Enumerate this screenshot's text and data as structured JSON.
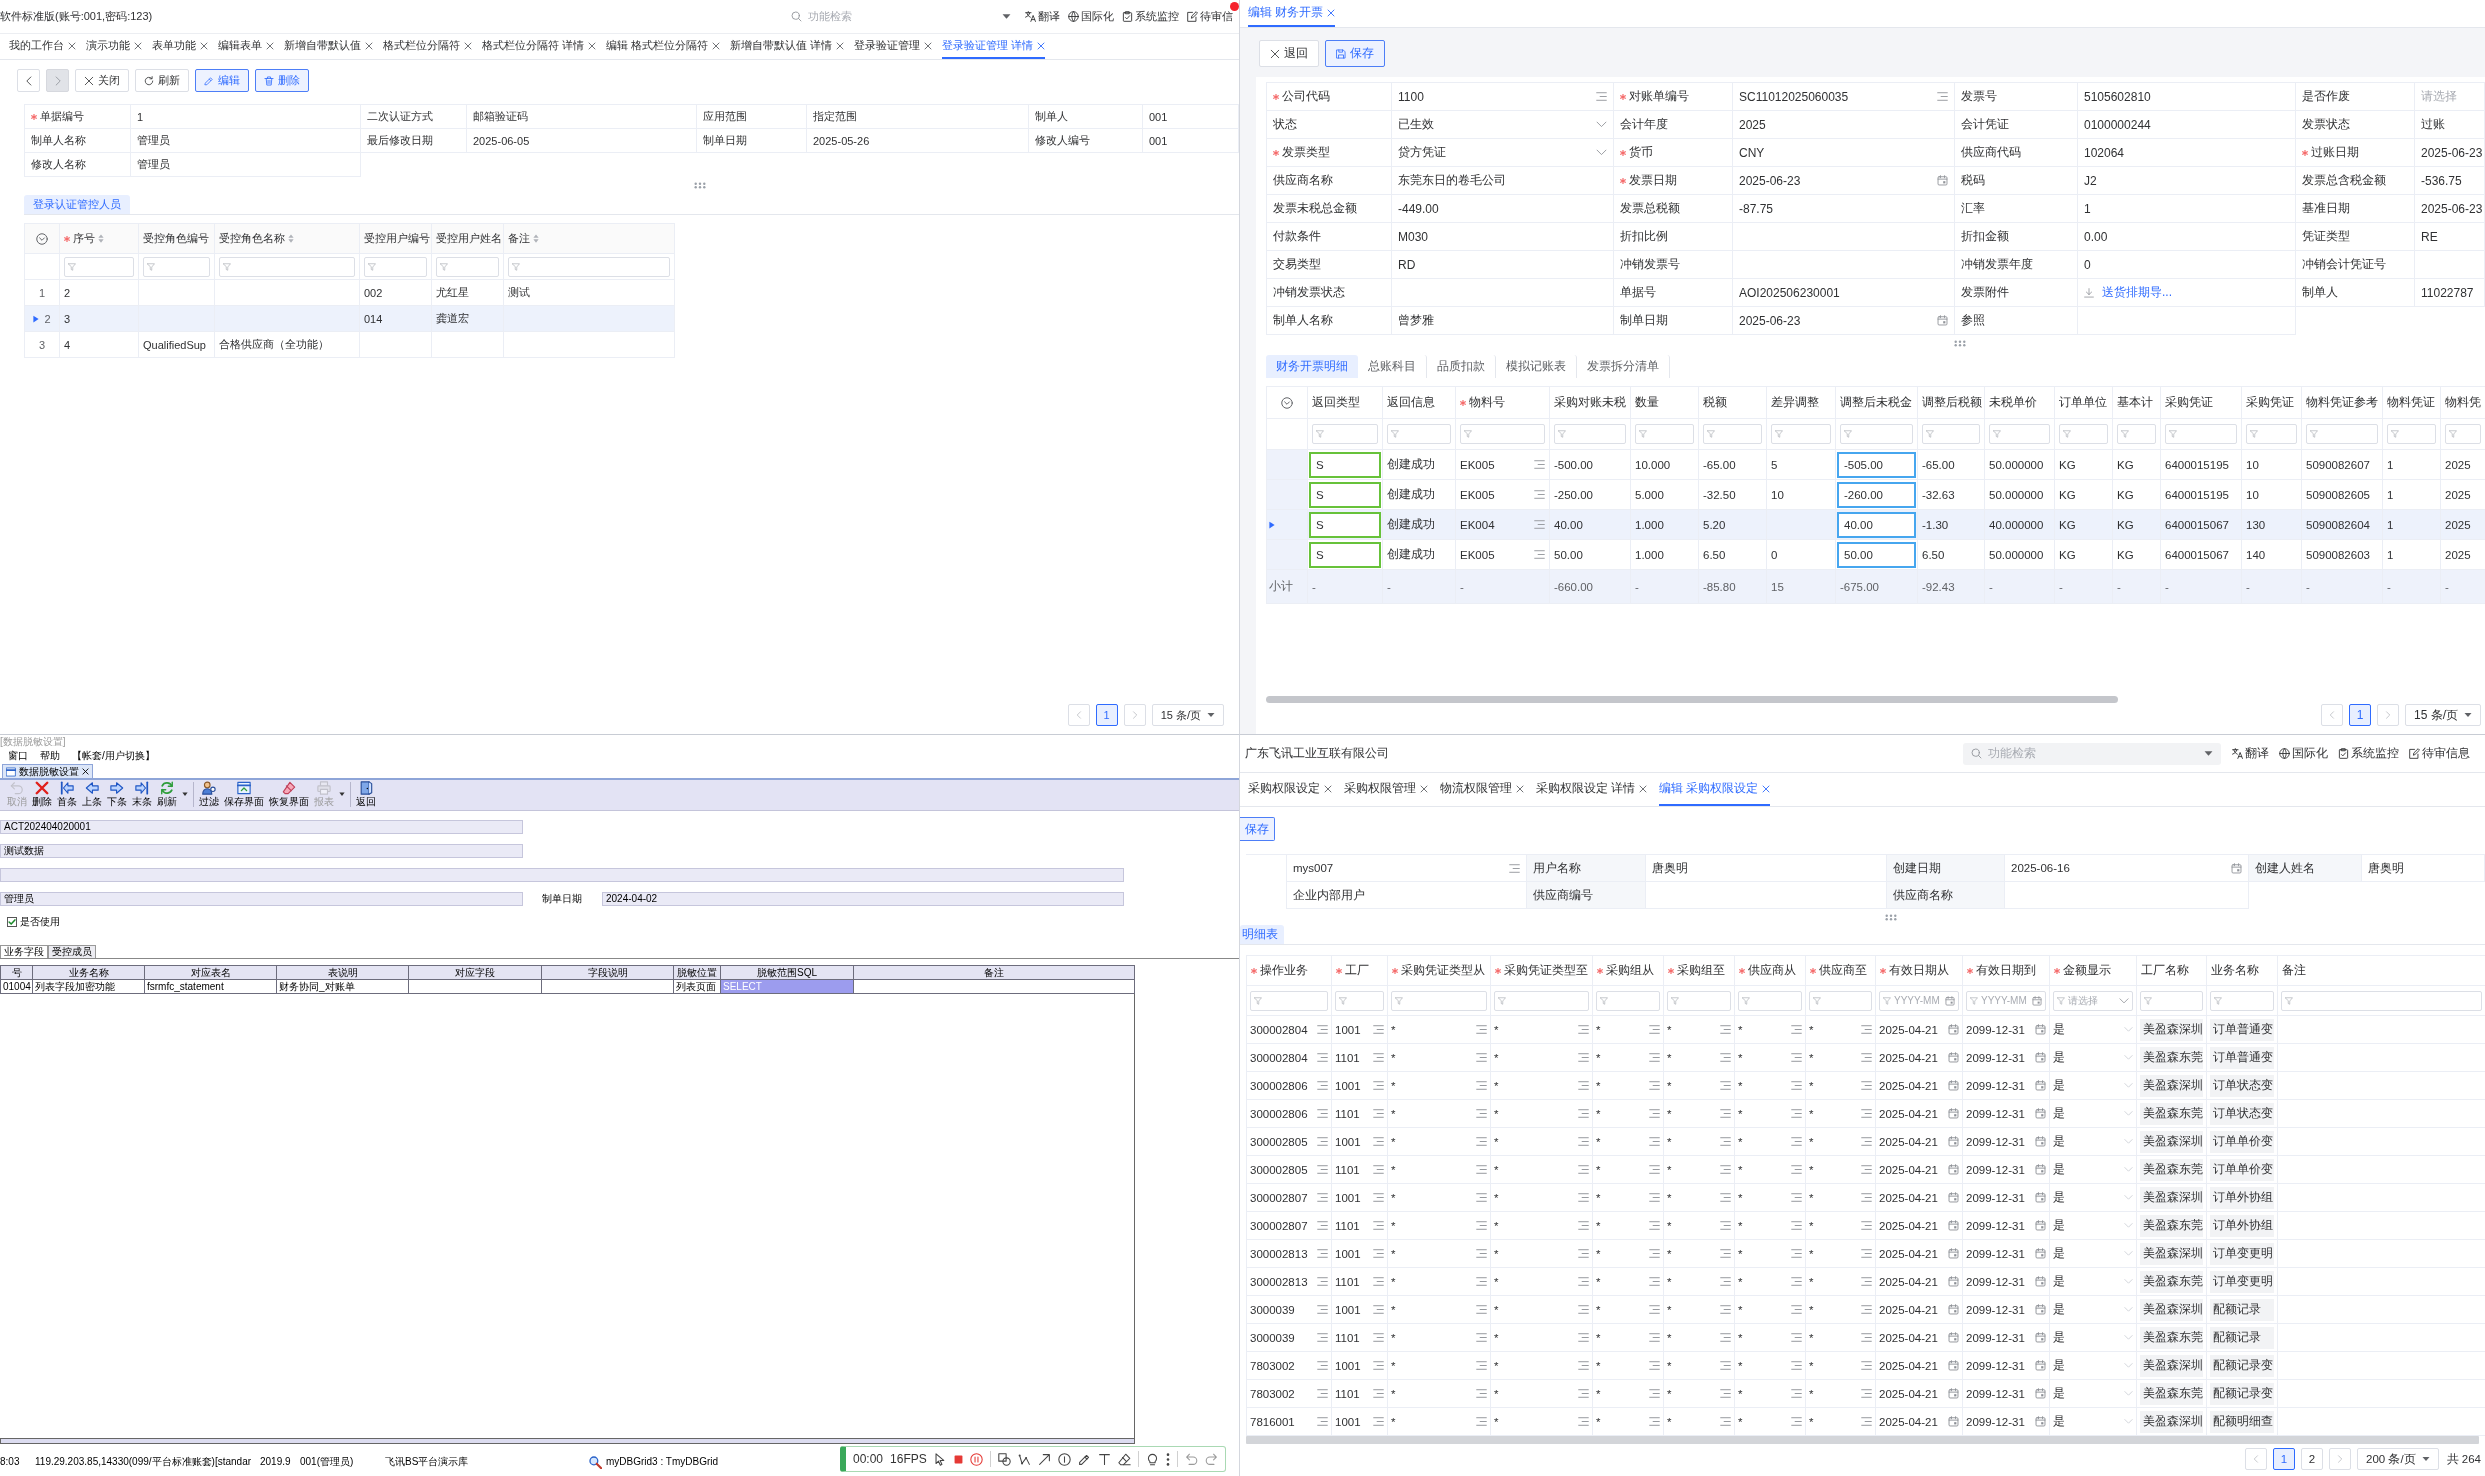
{
  "verify_page": {
    "header": {
      "title": "软件标准版(账号:001,密码:123)",
      "search": {
        "placeholder": "功能检索"
      },
      "links": [
        {
          "kind": "translate",
          "label": "翻译",
          "alert": false
        },
        {
          "kind": "globe",
          "label": "国际化",
          "alert": false
        },
        {
          "kind": "clipboard",
          "label": "系统监控",
          "alert": false
        },
        {
          "kind": "note",
          "label": "待审信",
          "alert": true
        }
      ]
    },
    "tabs": [
      {
        "label": "我的工作台",
        "selected": false
      },
      {
        "label": "演示功能",
        "selected": false
      },
      {
        "label": "表单功能",
        "selected": false
      },
      {
        "label": "编辑表单",
        "selected": false
      },
      {
        "label": "新增自带默认值",
        "selected": false
      },
      {
        "label": "格式栏位分隔符",
        "selected": false
      },
      {
        "label": "格式栏位分隔符 详情",
        "selected": false
      },
      {
        "label": "编辑 格式栏位分隔符",
        "selected": false
      },
      {
        "label": "新增自带默认值 详情",
        "selected": false
      },
      {
        "label": "登录验证管理",
        "selected": false
      },
      {
        "label": "登录验证管理 详情",
        "selected": true
      }
    ],
    "toolbar": [
      {
        "kind": "previous",
        "primary": false,
        "disabled": false
      },
      {
        "kind": "next",
        "primary": false,
        "disabled": true
      },
      {
        "kind": "close",
        "label": "关闭",
        "primary": false,
        "disabled": false
      },
      {
        "kind": "refresh",
        "label": "刷新",
        "primary": false,
        "disabled": false
      },
      {
        "kind": "edit",
        "label": "编辑",
        "primary": true,
        "disabled": false
      },
      {
        "kind": "delete",
        "label": "删除",
        "primary": true,
        "disabled": false
      }
    ],
    "form": {
      "fields": [
        {
          "label": "单据编号",
          "required": true,
          "value": "1"
        },
        {
          "label": "二次认证方式",
          "required": false,
          "value": "邮箱验证码"
        },
        {
          "label": "应用范围",
          "required": false,
          "value": "指定范围"
        },
        {
          "label": "制单人",
          "required": false,
          "value": "001"
        },
        {
          "label": "制单人名称",
          "required": false,
          "value": "管理员"
        },
        {
          "label": "最后修改日期",
          "required": false,
          "value": "2025-06-05"
        },
        {
          "label": "制单日期",
          "required": false,
          "value": "2025-05-26"
        },
        {
          "label": "修改人编号",
          "required": false,
          "value": "001"
        },
        {
          "label": "修改人名称",
          "required": false,
          "value": "管理员"
        }
      ]
    },
    "subtabs": [
      {
        "label": "登录认证管控人员",
        "selected": true
      }
    ],
    "grid": {
      "columns": [
        {
          "label": "序号",
          "required": true,
          "sortable": true
        },
        {
          "label": "受控角色编号",
          "required": false,
          "sortable": false
        },
        {
          "label": "受控角色名称",
          "required": false,
          "sortable": true
        },
        {
          "label": "受控用户编号",
          "required": false,
          "sortable": false
        },
        {
          "label": "受控用户姓名",
          "required": false,
          "sortable": false
        },
        {
          "label": "备注",
          "required": false,
          "sortable": true
        }
      ],
      "rows": [
        {
          "number": "1",
          "selected": false,
          "cells": [
            "2",
            null,
            null,
            "002",
            "尤红星",
            "测试"
          ]
        },
        {
          "number": "2",
          "selected": true,
          "cells": [
            "3",
            null,
            null,
            "014",
            "龚道宏",
            null
          ]
        },
        {
          "number": "3",
          "selected": false,
          "cells": [
            "4",
            "QualifiedSup",
            "合格供应商（全功能）",
            null,
            null,
            null
          ]
        }
      ]
    },
    "pagination": {
      "pages": [
        {
          "label": "1",
          "selected": true
        }
      ],
      "page_size": "15 条/页"
    }
  },
  "invoice_page": {
    "tabs": [
      {
        "label": "编辑 财务开票",
        "selected": true
      }
    ],
    "toolbar": [
      {
        "kind": "return",
        "label": "退回",
        "primary": false
      },
      {
        "kind": "save",
        "label": "保存",
        "primary": true
      }
    ],
    "form": {
      "fields": [
        {
          "label": "公司代码",
          "required": true,
          "kind": "lookup",
          "value": "1100"
        },
        {
          "label": "对账单编号",
          "required": true,
          "kind": "lookup",
          "value": "SC11012025060035"
        },
        {
          "label": "发票号",
          "required": false,
          "kind": "text",
          "value": "5105602810"
        },
        {
          "label": "是否作废",
          "required": false,
          "kind": "text",
          "placeholder": "请选择"
        },
        {
          "label": "状态",
          "required": false,
          "kind": "select",
          "value": "已生效"
        },
        {
          "label": "会计年度",
          "required": false,
          "kind": "text",
          "value": "2025"
        },
        {
          "label": "会计凭证",
          "required": false,
          "kind": "text",
          "value": "0100000244"
        },
        {
          "label": "发票状态",
          "required": false,
          "kind": "text",
          "value": "过账"
        },
        {
          "label": "发票类型",
          "required": true,
          "kind": "select",
          "value": "贷方凭证"
        },
        {
          "label": "货币",
          "required": true,
          "kind": "text",
          "value": "CNY"
        },
        {
          "label": "供应商代码",
          "required": false,
          "kind": "text",
          "value": "102064"
        },
        {
          "label": "过账日期",
          "required": true,
          "kind": "text",
          "value": "2025-06-23"
        },
        {
          "label": "供应商名称",
          "required": false,
          "kind": "text",
          "value": "东莞东日的卷毛公司"
        },
        {
          "label": "发票日期",
          "required": true,
          "kind": "date",
          "value": "2025-06-23"
        },
        {
          "label": "税码",
          "required": false,
          "kind": "text",
          "value": "J2"
        },
        {
          "label": "发票总含税金额",
          "required": false,
          "kind": "text",
          "value": "-536.75"
        },
        {
          "label": "发票未税总金额",
          "required": false,
          "kind": "text",
          "value": "-449.00"
        },
        {
          "label": "发票总税额",
          "required": false,
          "kind": "text",
          "value": "-87.75"
        },
        {
          "label": "汇率",
          "required": false,
          "kind": "text",
          "value": "1"
        },
        {
          "label": "基准日期",
          "required": false,
          "kind": "text",
          "value": "2025-06-23"
        },
        {
          "label": "付款条件",
          "required": false,
          "kind": "text",
          "value": "M030"
        },
        {
          "label": "折扣比例",
          "required": false,
          "kind": "text"
        },
        {
          "label": "折扣金额",
          "required": false,
          "kind": "text",
          "value": "0.00"
        },
        {
          "label": "凭证类型",
          "required": false,
          "kind": "text",
          "value": "RE"
        },
        {
          "label": "交易类型",
          "required": false,
          "kind": "text",
          "value": "RD"
        },
        {
          "label": "冲销发票号",
          "required": false,
          "kind": "text"
        },
        {
          "label": "冲销发票年度",
          "required": false,
          "kind": "text",
          "value": "0"
        },
        {
          "label": "冲销会计凭证号",
          "required": false,
          "kind": "text"
        },
        {
          "label": "冲销发票状态",
          "required": false,
          "kind": "text"
        },
        {
          "label": "单据号",
          "required": false,
          "kind": "text",
          "value": "AOI202506230001"
        },
        {
          "label": "发票附件",
          "required": false,
          "kind": "attachment",
          "value": "送货排期导..."
        },
        {
          "label": "制单人",
          "required": false,
          "kind": "text",
          "value": "11022787"
        },
        {
          "label": "制单人名称",
          "required": false,
          "kind": "text",
          "value": "曾梦雅"
        },
        {
          "label": "制单日期",
          "required": false,
          "kind": "date",
          "value": "2025-06-23"
        },
        {
          "label": "参照",
          "required": false,
          "kind": "text"
        }
      ]
    },
    "subtabs": [
      {
        "label": "财务开票明细",
        "selected": true
      },
      {
        "label": "总账科目",
        "selected": false
      },
      {
        "label": "品质扣款",
        "selected": false
      },
      {
        "label": "模拟记账表",
        "selected": false
      },
      {
        "label": "发票拆分清单",
        "selected": false
      }
    ],
    "grid": {
      "columns": [
        {
          "label": "返回类型",
          "required": false,
          "kind": "valid"
        },
        {
          "label": "返回信息",
          "required": false,
          "kind": "plain"
        },
        {
          "label": "物料号",
          "required": true,
          "kind": "lookup"
        },
        {
          "label": "采购对账未税",
          "required": false,
          "kind": "plain"
        },
        {
          "label": "数量",
          "required": false,
          "kind": "plain"
        },
        {
          "label": "税额",
          "required": false,
          "kind": "plain"
        },
        {
          "label": "差异调整",
          "required": false,
          "kind": "plain"
        },
        {
          "label": "调整后未税金",
          "required": false,
          "kind": "editing"
        },
        {
          "label": "调整后税额",
          "required": false,
          "kind": "plain"
        },
        {
          "label": "未税单价",
          "required": false,
          "kind": "plain"
        },
        {
          "label": "订单单位",
          "required": false,
          "kind": "plain"
        },
        {
          "label": "基本计",
          "required": false,
          "kind": "plain"
        },
        {
          "label": "采购凭证",
          "required": false,
          "kind": "plain"
        },
        {
          "label": "采购凭证",
          "required": false,
          "kind": "plain"
        },
        {
          "label": "物料凭证参考",
          "required": false,
          "kind": "plain"
        },
        {
          "label": "物料凭证",
          "required": false,
          "kind": "plain"
        },
        {
          "label": "物料凭",
          "required": false,
          "kind": "plain"
        }
      ],
      "rows": [
        {
          "selected": false,
          "cells": [
            "S",
            "创建成功",
            "EK005",
            "-500.00",
            "10.000",
            "-65.00",
            "5",
            "-505.00",
            "-65.00",
            "50.000000",
            "KG",
            "KG",
            "6400015195",
            "10",
            "5090082607",
            "1",
            "2025"
          ]
        },
        {
          "selected": false,
          "cells": [
            "S",
            "创建成功",
            "EK005",
            "-250.00",
            "5.000",
            "-32.50",
            "10",
            "-260.00",
            "-32.63",
            "50.000000",
            "KG",
            "KG",
            "6400015195",
            "10",
            "5090082605",
            "1",
            "2025"
          ]
        },
        {
          "selected": true,
          "cells": [
            "S",
            "创建成功",
            "EK004",
            "40.00",
            "1.000",
            "5.20",
            null,
            "40.00",
            "-1.30",
            "40.000000",
            "KG",
            "KG",
            "6400015067",
            "130",
            "5090082604",
            "1",
            "2025"
          ]
        },
        {
          "selected": false,
          "cells": [
            "S",
            "创建成功",
            "EK005",
            "50.00",
            "1.000",
            "6.50",
            "0",
            "50.00",
            "6.50",
            "50.000000",
            "KG",
            "KG",
            "6400015067",
            "140",
            "5090082603",
            "1",
            "2025"
          ]
        }
      ],
      "subtotal": {
        "label": "小计",
        "cells": [
          "-",
          "-",
          "-",
          "-660.00",
          "-",
          "-85.80",
          "15",
          "-675.00",
          "-92.43",
          "-",
          "-",
          "-",
          "-",
          "-",
          "-",
          "-",
          "-"
        ]
      }
    },
    "pagination": {
      "pages": [
        {
          "label": "1",
          "selected": true
        }
      ],
      "page_size": "15 条/页"
    }
  },
  "masking_window": {
    "caption": "[数据脱敏设置]",
    "menu": [
      "窗口",
      "帮助",
      "【帐套/用户切换】"
    ],
    "document_tab": {
      "label": "数据脱敏设置"
    },
    "toolbar": [
      {
        "kind": "cancel",
        "label": "取消",
        "disabled": true
      },
      {
        "kind": "delete",
        "label": "删除",
        "disabled": false
      },
      {
        "kind": "first",
        "label": "首条",
        "disabled": false
      },
      {
        "kind": "previous",
        "label": "上条",
        "disabled": false
      },
      {
        "kind": "next",
        "label": "下条",
        "disabled": false
      },
      {
        "kind": "last",
        "label": "末条",
        "disabled": false
      },
      {
        "kind": "refresh",
        "label": "刷新",
        "disabled": false
      },
      {
        "kind": "dropdown",
        "disabled": false
      },
      {
        "kind": "filter",
        "label": "过滤",
        "disabled": false
      },
      {
        "kind": "save_layout",
        "label": "保存界面",
        "disabled": false
      },
      {
        "kind": "restore_layout",
        "label": "恢复界面",
        "disabled": false
      },
      {
        "kind": "report",
        "label": "报表",
        "disabled": true
      },
      {
        "kind": "dropdown",
        "disabled": false
      },
      {
        "kind": "return",
        "label": "返回",
        "disabled": false
      }
    ],
    "form": {
      "field_1": "ACT202404020001",
      "field_2": "测试数据",
      "field_4": "管理员",
      "date": {
        "label": "制单日期",
        "value": "2024-04-02"
      },
      "checkbox": {
        "label": "是否使用",
        "checked": true
      }
    },
    "tabs": [
      {
        "label": "业务字段",
        "selected": true
      },
      {
        "label": "受控成员",
        "selected": false
      }
    ],
    "grid": {
      "columns": [
        "号",
        "业务名称",
        "对应表名",
        "表说明",
        "对应字段",
        "字段说明",
        "脱敏位置",
        "脱敏范围SQL",
        "备注"
      ],
      "rows": [
        {
          "cells": [
            {
              "text": "01004",
              "selected": false
            },
            {
              "text": "列表字段加密功能",
              "selected": false
            },
            {
              "text": "fsrmfc_statement",
              "selected": false
            },
            {
              "text": "财务协同_对账单",
              "selected": false
            },
            null,
            null,
            {
              "text": "列表页面",
              "selected": false
            },
            {
              "text": "SELECT",
              "selected": true
            },
            null
          ]
        }
      ]
    },
    "status_bar": {
      "items": [
        "8:03",
        "119.29.203.85,14330(099/平台标准账套)[standar",
        "2019.9",
        "001(管理员)",
        "飞讯BS平台演示库"
      ],
      "component": "myDBGrid3 : TmyDBGrid"
    },
    "recorder": {
      "time": "00:00",
      "fps": "16FPS",
      "controls": [
        {
          "kind": "cursor"
        },
        {
          "kind": "stop"
        },
        {
          "kind": "pause"
        }
      ],
      "tool_groups": [
        [
          {
            "kind": "shapes"
          },
          {
            "kind": "polyline"
          },
          {
            "kind": "arrow"
          },
          {
            "kind": "counter"
          },
          {
            "kind": "pencil"
          },
          {
            "kind": "text"
          },
          {
            "kind": "eraser"
          }
        ],
        [
          {
            "kind": "bulb"
          },
          {
            "kind": "more"
          }
        ],
        [
          {
            "kind": "undo"
          },
          {
            "kind": "redo"
          }
        ]
      ]
    }
  },
  "permission_page": {
    "header": {
      "title": "广东飞讯工业互联有限公司",
      "search": {
        "placeholder": "功能检索"
      },
      "links": [
        {
          "kind": "translate",
          "label": "翻译",
          "alert": false
        },
        {
          "kind": "globe",
          "label": "国际化",
          "alert": false
        },
        {
          "kind": "clipboard",
          "label": "系统监控",
          "alert": false
        },
        {
          "kind": "note",
          "label": "待审信息",
          "alert": false
        }
      ]
    },
    "tabs": [
      {
        "label": "采购权限设定",
        "selected": false
      },
      {
        "label": "采购权限管理",
        "selected": false
      },
      {
        "label": "物流权限管理",
        "selected": false
      },
      {
        "label": "采购权限设定 详情",
        "selected": false
      },
      {
        "label": "编辑 采购权限设定",
        "selected": true
      }
    ],
    "toolbar": [
      {
        "kind": "plain",
        "label": "保存",
        "primary": true
      }
    ],
    "form": {
      "fields": [
        {
          "kind": "lookup",
          "value": "mys007"
        },
        {
          "label": "用户名称",
          "kind": "text",
          "value": "唐奥明"
        },
        {
          "label": "创建日期",
          "kind": "date",
          "value": "2025-06-16"
        },
        {
          "label": "创建人姓名",
          "kind": "text",
          "value": "唐奥明"
        },
        {
          "kind": "text",
          "value": "企业内部用户"
        },
        {
          "label": "供应商编号",
          "kind": "text"
        },
        {
          "label": "供应商名称",
          "kind": "text"
        }
      ]
    },
    "subtabs": [
      {
        "label": "明细表",
        "selected": true
      }
    ],
    "grid": {
      "columns": [
        {
          "label": "操作业务",
          "required": true,
          "kind": "lookup"
        },
        {
          "label": "工厂",
          "required": true,
          "kind": "lookup"
        },
        {
          "label": "采购凭证类型从",
          "required": true,
          "kind": "lookup"
        },
        {
          "label": "采购凭证类型至",
          "required": true,
          "kind": "lookup"
        },
        {
          "label": "采购组从",
          "required": true,
          "kind": "lookup"
        },
        {
          "label": "采购组至",
          "required": true,
          "kind": "lookup"
        },
        {
          "label": "供应商从",
          "required": true,
          "kind": "lookup"
        },
        {
          "label": "供应商至",
          "required": true,
          "kind": "lookup"
        },
        {
          "label": "有效日期从",
          "required": true,
          "kind": "date",
          "filter": {
            "placeholder": "YYYY-MM"
          }
        },
        {
          "label": "有效日期到",
          "required": true,
          "kind": "date",
          "filter": {
            "placeholder": "YYYY-MM"
          }
        },
        {
          "label": "金额显示",
          "required": true,
          "kind": "select",
          "filter": {
            "placeholder": "请选择"
          }
        },
        {
          "label": "工厂名称",
          "required": false,
          "kind": "readonly"
        },
        {
          "label": "业务名称",
          "required": false,
          "kind": "readonly"
        },
        {
          "label": "备注",
          "required": false,
          "kind": "text"
        }
      ],
      "rows": [
        {
          "cells": [
            "300002804",
            "1001",
            "*",
            "*",
            "*",
            "*",
            "*",
            "*",
            "2025-04-21",
            "2099-12-31",
            "是",
            "美盈森深圳",
            "订单普通变"
          ]
        },
        {
          "cells": [
            "300002804",
            "1101",
            "*",
            "*",
            "*",
            "*",
            "*",
            "*",
            "2025-04-21",
            "2099-12-31",
            "是",
            "美盈森东莞",
            "订单普通变"
          ]
        },
        {
          "cells": [
            "300002806",
            "1001",
            "*",
            "*",
            "*",
            "*",
            "*",
            "*",
            "2025-04-21",
            "2099-12-31",
            "是",
            "美盈森深圳",
            "订单状态变"
          ]
        },
        {
          "cells": [
            "300002806",
            "1101",
            "*",
            "*",
            "*",
            "*",
            "*",
            "*",
            "2025-04-21",
            "2099-12-31",
            "是",
            "美盈森东莞",
            "订单状态变"
          ]
        },
        {
          "cells": [
            "300002805",
            "1001",
            "*",
            "*",
            "*",
            "*",
            "*",
            "*",
            "2025-04-21",
            "2099-12-31",
            "是",
            "美盈森深圳",
            "订单单价变"
          ]
        },
        {
          "cells": [
            "300002805",
            "1101",
            "*",
            "*",
            "*",
            "*",
            "*",
            "*",
            "2025-04-21",
            "2099-12-31",
            "是",
            "美盈森东莞",
            "订单单价变"
          ]
        },
        {
          "cells": [
            "300002807",
            "1001",
            "*",
            "*",
            "*",
            "*",
            "*",
            "*",
            "2025-04-21",
            "2099-12-31",
            "是",
            "美盈森深圳",
            "订单外协组"
          ]
        },
        {
          "cells": [
            "300002807",
            "1101",
            "*",
            "*",
            "*",
            "*",
            "*",
            "*",
            "2025-04-21",
            "2099-12-31",
            "是",
            "美盈森东莞",
            "订单外协组"
          ]
        },
        {
          "cells": [
            "300002813",
            "1001",
            "*",
            "*",
            "*",
            "*",
            "*",
            "*",
            "2025-04-21",
            "2099-12-31",
            "是",
            "美盈森深圳",
            "订单变更明"
          ]
        },
        {
          "cells": [
            "300002813",
            "1101",
            "*",
            "*",
            "*",
            "*",
            "*",
            "*",
            "2025-04-21",
            "2099-12-31",
            "是",
            "美盈森东莞",
            "订单变更明"
          ]
        },
        {
          "cells": [
            "3000039",
            "1001",
            "*",
            "*",
            "*",
            "*",
            "*",
            "*",
            "2025-04-21",
            "2099-12-31",
            "是",
            "美盈森深圳",
            "配额记录"
          ]
        },
        {
          "cells": [
            "3000039",
            "1101",
            "*",
            "*",
            "*",
            "*",
            "*",
            "*",
            "2025-04-21",
            "2099-12-31",
            "是",
            "美盈森东莞",
            "配额记录"
          ]
        },
        {
          "cells": [
            "7803002",
            "1001",
            "*",
            "*",
            "*",
            "*",
            "*",
            "*",
            "2025-04-21",
            "2099-12-31",
            "是",
            "美盈森深圳",
            "配额记录变"
          ]
        },
        {
          "cells": [
            "7803002",
            "1101",
            "*",
            "*",
            "*",
            "*",
            "*",
            "*",
            "2025-04-21",
            "2099-12-31",
            "是",
            "美盈森东莞",
            "配额记录变"
          ]
        },
        {
          "cells": [
            "7816001",
            "1001",
            "*",
            "*",
            "*",
            "*",
            "*",
            "*",
            "2025-04-21",
            "2099-12-31",
            "是",
            "美盈森深圳",
            "配额明细查"
          ]
        }
      ]
    },
    "pagination": {
      "pages": [
        {
          "label": "1",
          "selected": true
        },
        {
          "label": "2",
          "selected": false
        }
      ],
      "page_size": "200 条/页",
      "total": "共 264"
    }
  }
}
